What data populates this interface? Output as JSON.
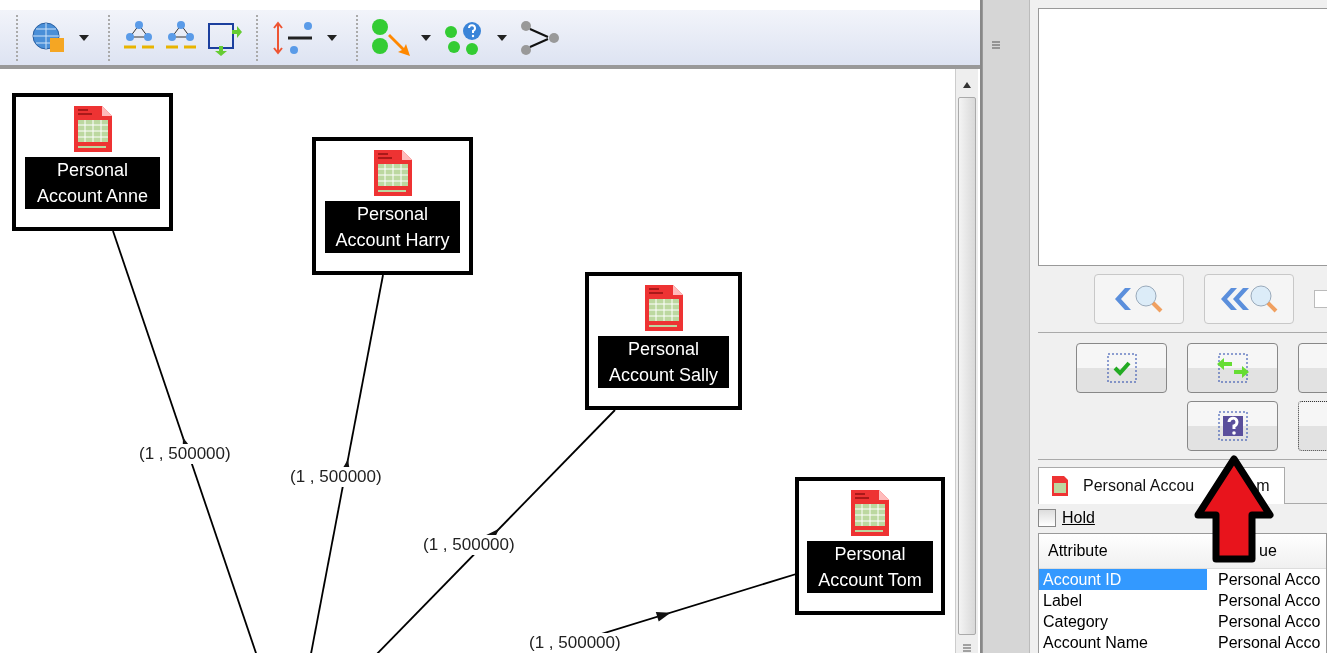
{
  "diagram": {
    "nodes": [
      {
        "label": "Personal Account Anne"
      },
      {
        "label": "Personal Account Harry"
      },
      {
        "label": "Personal Account Sally"
      },
      {
        "label": "Personal Account Tom"
      }
    ],
    "edges": [
      {
        "label": "(1 , 500000)"
      },
      {
        "label": "(1 , 500000)"
      },
      {
        "label": "(1 , 500000)"
      },
      {
        "label": "(1 , 500000)"
      }
    ]
  },
  "panel": {
    "search_option": {
      "checked": false
    },
    "tab": {
      "label": "Personal Accou",
      "label_end": "m",
      "selected": true
    },
    "hold": {
      "label": "Hold",
      "checked": false
    },
    "table": {
      "columns": [
        "Attribute",
        "ue"
      ],
      "rows": [
        {
          "attribute": "Account ID",
          "value": "Personal Acco",
          "selected": true
        },
        {
          "attribute": "Label",
          "value": "Personal Acco",
          "selected": false
        },
        {
          "attribute": "Category",
          "value": "Personal Acco",
          "selected": false
        },
        {
          "attribute": "Account Name",
          "value": "Personal Acco",
          "selected": false
        }
      ]
    }
  }
}
